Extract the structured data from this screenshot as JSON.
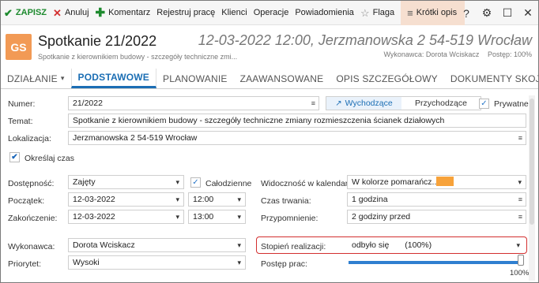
{
  "toolbar": {
    "save": "ZAPISZ",
    "cancel": "Anuluj",
    "comment": "Komentarz",
    "register_work": "Rejestruj pracę",
    "clients": "Klienci",
    "operations": "Operacje",
    "notifications": "Powiadomienia",
    "flag": "Flaga",
    "short_desc": "Krótki opis"
  },
  "header": {
    "initials": "GS",
    "title": "Spotkanie 21/2022",
    "subtitle": "Spotkanie z kierownikiem budowy - szczegóły techniczne zmi...",
    "right_title": "12-03-2022 12:00, Jerzmanowska 2 54-519 Wrocław",
    "executor": "Wykonawca: Dorota Wciskacz",
    "progress": "Postęp: 100%"
  },
  "tabs": {
    "dzialanie": "DZIAŁANIE",
    "podstawowe": "PODSTAWOWE",
    "planowanie": "PLANOWANIE",
    "zaawansowane": "ZAAWANSOWANE",
    "opis": "OPIS SZCZEGÓŁOWY",
    "dokumenty": "DOKUMENTY SKOJARZONE"
  },
  "form": {
    "numer_label": "Numer:",
    "numer_value": "21/2022",
    "direction_out": "Wychodzące",
    "direction_in": "Przychodzące",
    "private_label": "Prywatne",
    "temat_label": "Temat:",
    "temat_value": "Spotkanie z kierownikiem budowy - szczegóły techniczne zmiany rozmieszczenia ścianek działowych",
    "lokalizacja_label": "Lokalizacja:",
    "lokalizacja_value": "Jerzmanowska 2 54-519 Wrocław",
    "okreslaj_czas_label": "Określaj czas",
    "dostepnosc_label": "Dostępność:",
    "dostepnosc_value": "Zajęty",
    "calodzienne_label": "Całodzienne",
    "poczatek_label": "Początek:",
    "poczatek_date": "12-03-2022",
    "poczatek_time": "12:00",
    "zakonczenie_label": "Zakończenie:",
    "zakonczenie_date": "12-03-2022",
    "zakonczenie_time": "13:00",
    "widocznosc_label": "Widoczność w kalendarzu:",
    "widocznosc_value": "W kolorze pomarańcz...",
    "czas_trwania_label": "Czas trwania:",
    "czas_trwania_value": "1 godzina",
    "przypomnienie_label": "Przypomnienie:",
    "przypomnienie_value": "2 godziny przed",
    "wykonawca_label": "Wykonawca:",
    "wykonawca_value": "Dorota Wciskacz",
    "priorytet_label": "Priorytet:",
    "priorytet_value": "Wysoki",
    "stopien_label": "Stopień realizacji:",
    "stopien_value": "odbyło się",
    "stopien_pct": "(100%)",
    "postep_label": "Postęp prac:",
    "postep_value": "100%"
  },
  "progress_fraction": 1.0,
  "colors": {
    "accent": "#1b6eb4",
    "save_green": "#1d8a2e",
    "avatar_orange": "#f29a55",
    "highlight_red": "#d32f2f",
    "calendar_orange": "#f7a23a"
  }
}
